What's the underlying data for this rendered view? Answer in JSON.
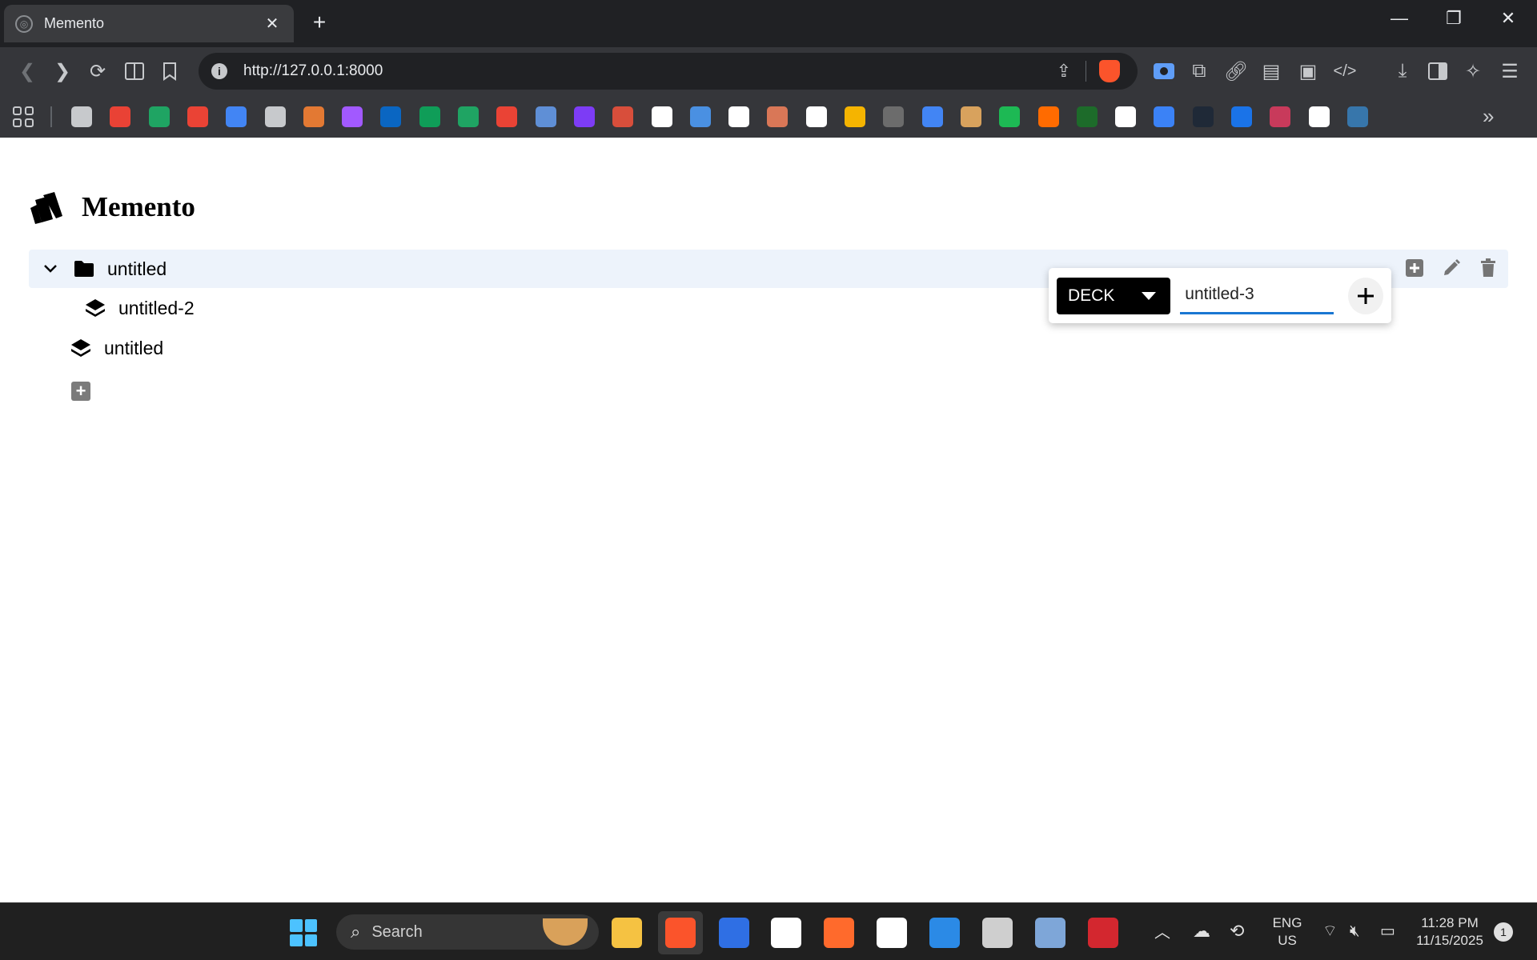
{
  "browser": {
    "tab_title": "Memento",
    "tab_close": "✕",
    "new_tab": "+",
    "url": "http://127.0.0.1:8000",
    "window_controls": {
      "minimize": "—",
      "restore": "❐",
      "close": "✕"
    },
    "bookmarks_more": "»",
    "bookmark_colors": [
      "#c7c9cc",
      "#e94235",
      "#1fa463",
      "#ea4335",
      "#4285f4",
      "#c7c9cc",
      "#e37933",
      "#a259ff",
      "#0a66c2",
      "#0f9d58",
      "#1fa463",
      "#ea4335",
      "#5f8fd6",
      "#7d3cf5",
      "#d84e3b",
      "#ffffff",
      "#4a90e2",
      "#ffffff",
      "#d97757",
      "#ffffff",
      "#f5b400",
      "#6c6c6c",
      "#4285f4",
      "#d8a25d",
      "#1db954",
      "#ff6b00",
      "#1d6b2a",
      "#ffffff",
      "#3b82f6",
      "#1f2937",
      "#1a73e8",
      "#c83a5b",
      "#ffffff",
      "#3776ab"
    ]
  },
  "app": {
    "title": "Memento"
  },
  "tree": {
    "folder": {
      "label": "untitled"
    },
    "child_deck": {
      "label": "untitled-2"
    },
    "root_deck": {
      "label": "untitled"
    },
    "add_label": "+"
  },
  "popover": {
    "type_label": "DECK",
    "name_value": "untitled-3",
    "name_placeholder": ""
  },
  "taskbar": {
    "search_label": "Search",
    "lang_1": "ENG",
    "lang_2": "US",
    "time": "11:28 PM",
    "date": "11/15/2025",
    "notifications": "1",
    "app_colors": [
      "#f5c242",
      "#fb542b",
      "#2f6fe4",
      "#ffffff",
      "#ff6a2c",
      "#ffffff",
      "#2b8ae6",
      "#cfcfcf",
      "#7ea6d8",
      "#d3272f"
    ]
  }
}
